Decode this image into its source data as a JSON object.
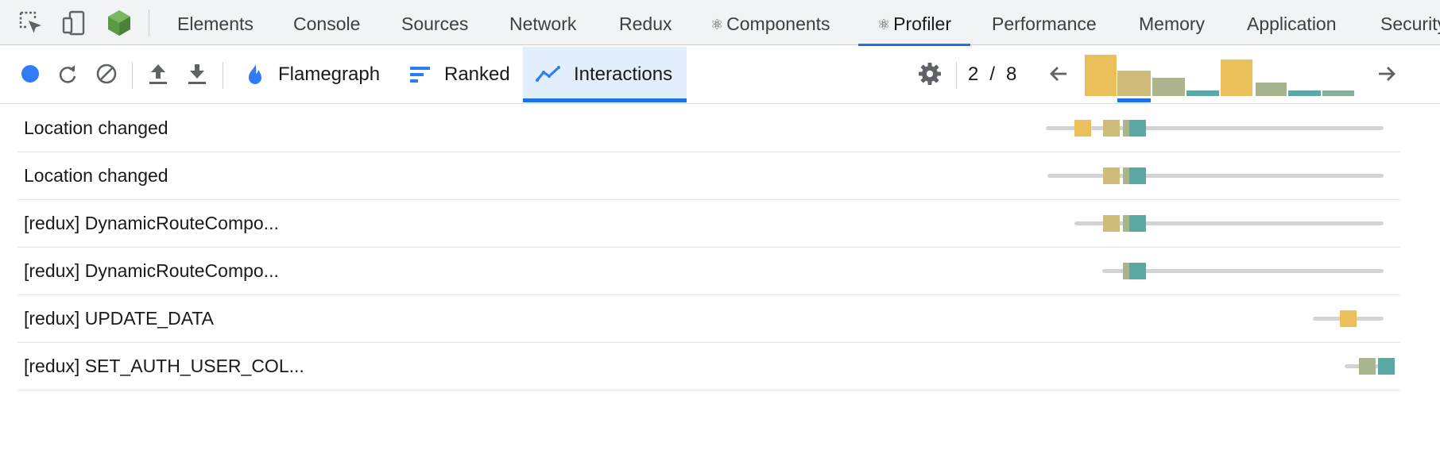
{
  "devtools": {
    "tabs": [
      {
        "label": "Elements"
      },
      {
        "label": "Console"
      },
      {
        "label": "Sources"
      },
      {
        "label": "Network"
      },
      {
        "label": "Redux"
      },
      {
        "label": "Components",
        "react_glyph": "⚛"
      },
      {
        "label": "Profiler",
        "react_glyph": "⚛",
        "active": true
      },
      {
        "label": "Performance"
      },
      {
        "label": "Memory"
      },
      {
        "label": "Application"
      },
      {
        "label": "Security"
      }
    ],
    "icons": [
      "inspect-element-icon",
      "device-toolbar-icon",
      "node-hexagon-icon"
    ]
  },
  "profiler": {
    "buttons": [
      "record-icon",
      "reload-icon",
      "clear-icon",
      "upload-icon",
      "download-icon"
    ],
    "view_tabs": [
      {
        "label": "Flamegraph",
        "icon": "flame-icon"
      },
      {
        "label": "Ranked",
        "icon": "ranked-bars-icon"
      },
      {
        "label": "Interactions",
        "icon": "interactions-line-icon",
        "active": true
      }
    ],
    "commit_current": "2",
    "commit_separator": "/",
    "commit_total": "8",
    "commit_bars": [
      {
        "level": 0.9,
        "color": "#ebbf59"
      },
      {
        "level": 0.55,
        "color": "#cfbc7a"
      },
      {
        "level": 0.4,
        "color": "#aeb48d"
      },
      {
        "level": 0.12,
        "color": "#5ba9a4"
      },
      {
        "level": 0.8,
        "color": "#ebbf59"
      },
      {
        "level": 0.3,
        "color": "#a6b38c"
      },
      {
        "level": 0.12,
        "color": "#5ba9a4"
      },
      {
        "level": 0.12,
        "color": "#85af99"
      }
    ],
    "selected_commit": 1
  },
  "colors": {
    "accent": "#1a73e8",
    "active_tab_bg": "#e3eefc",
    "commit_yellow": "#ebbf59",
    "commit_khaki": "#cfbc7a",
    "commit_sage": "#a7b68d",
    "commit_teal": "#5ba9a4",
    "track": "#d3d3d6"
  },
  "interactions": [
    {
      "name": "Location changed",
      "commits": [
        {
          "commit": 1,
          "color": "#ebbf59"
        },
        {
          "commit": 2,
          "color": "#cfbc7a"
        },
        {
          "commit": 3,
          "color": "#a7b68d"
        },
        {
          "commit": 4,
          "color": "#5ba9a4"
        }
      ]
    },
    {
      "name": "Location changed",
      "commits": [
        {
          "commit": 2,
          "color": "#cfbc7a"
        },
        {
          "commit": 3,
          "color": "#a7b68d"
        },
        {
          "commit": 4,
          "color": "#5ba9a4"
        }
      ]
    },
    {
      "name": "[redux] DynamicRouteCompo...",
      "commits": [
        {
          "commit": 2,
          "color": "#cfbc7a"
        },
        {
          "commit": 3,
          "color": "#a7b68d"
        },
        {
          "commit": 4,
          "color": "#5ba9a4"
        }
      ]
    },
    {
      "name": "[redux] DynamicRouteCompo...",
      "commits": [
        {
          "commit": 3,
          "color": "#a7b68d"
        },
        {
          "commit": 4,
          "color": "#5ba9a4"
        }
      ]
    },
    {
      "name": "[redux] UPDATE_DATA",
      "commits": [
        {
          "commit": 7,
          "color": "#ebbf59"
        }
      ]
    },
    {
      "name": "[redux] SET_AUTH_USER_COL...",
      "commits": [
        {
          "commit": 8,
          "color": "#a7b68d"
        },
        {
          "commit": 9,
          "color": "#5ba9a4"
        }
      ]
    }
  ]
}
